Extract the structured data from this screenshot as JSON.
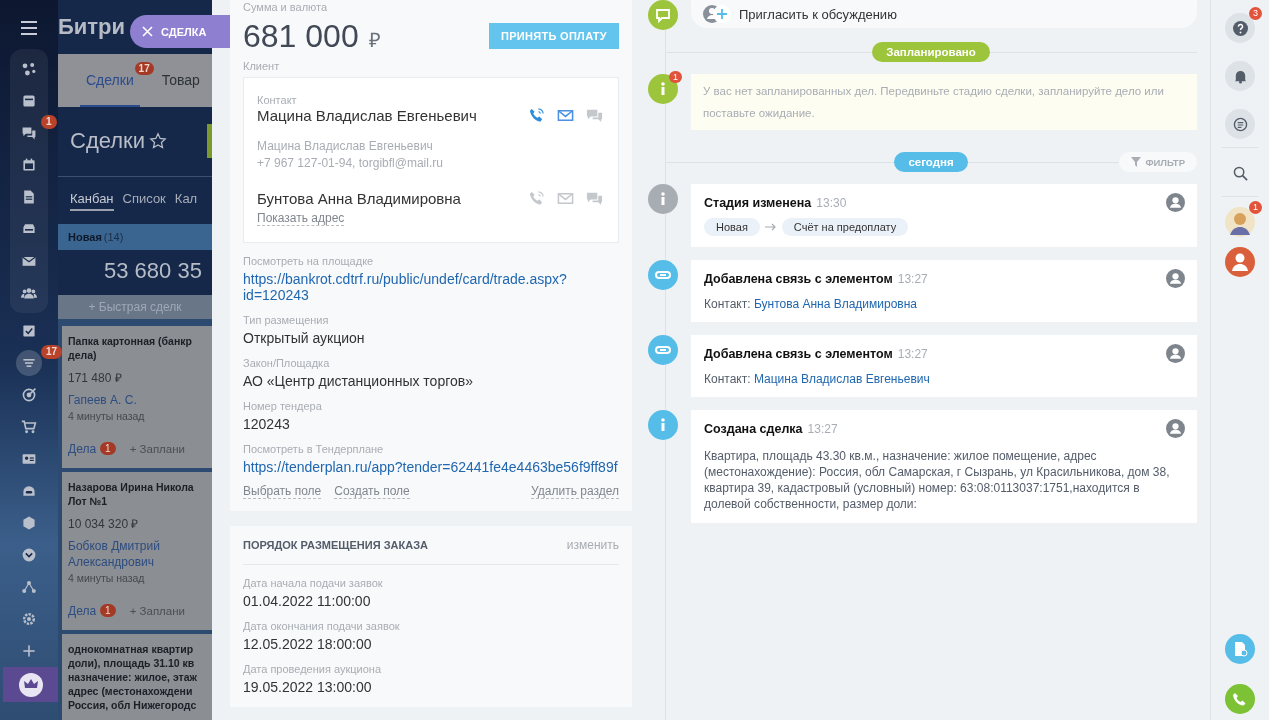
{
  "nav": {
    "pinned": [
      {
        "selected": false
      },
      {
        "selected": false
      },
      {
        "selected": false,
        "badge": "1"
      },
      {
        "selected": false
      },
      {
        "selected": false
      },
      {
        "selected": false
      },
      {
        "selected": false
      },
      {
        "selected": false
      }
    ],
    "items": [
      {
        "selected": false
      },
      {
        "selected": true,
        "badge": "17"
      },
      {
        "selected": false
      },
      {
        "selected": false
      },
      {
        "selected": false
      },
      {
        "selected": false
      },
      {
        "selected": false
      },
      {
        "selected": false
      },
      {
        "selected": false
      },
      {
        "selected": false
      },
      {
        "selected": false
      }
    ]
  },
  "app_title": "Битри",
  "slider_tab": {
    "label": "СДЕЛКА"
  },
  "crm_tabs": [
    {
      "label": "Сделки",
      "badge": "17",
      "selected": true
    },
    {
      "label": "Товар",
      "selected": false
    }
  ],
  "page_title": "Сделки",
  "views": [
    {
      "label": "Канбан",
      "selected": true
    },
    {
      "label": "Список",
      "selected": false
    },
    {
      "label": "Кал",
      "selected": false
    }
  ],
  "kanban_column": {
    "name": "Новая",
    "count": "(14)",
    "total": "53 680 35",
    "quick_add": "+ Быстрая сделк",
    "cards": [
      {
        "title": [
          "Папка картонная (банкр",
          "дела)"
        ],
        "price": "171 480 ₽",
        "person": "Гапеев А. С.",
        "time": "4 минуты назад",
        "activity": "Дела",
        "activity_badge": "1",
        "plan": "+ Заплани"
      },
      {
        "title": [
          "Назарова Ирина Никола",
          "Лот №1"
        ],
        "price": "10 034 320 ₽",
        "person": "Бобков Дмитрий Александрович",
        "time": "4 минуты назад",
        "activity": "Дела",
        "activity_badge": "1",
        "plan": "+ Заплани"
      },
      {
        "title": [
          "однокомнатная квартир",
          "доли), площадь 31.10 кв",
          "назначение: жилое, этаж",
          "адрес (местонахождени",
          "Россия, обл Нижегородс"
        ]
      }
    ]
  },
  "deal": {
    "amount_label": "Сумма и валюта",
    "amount": "681 000",
    "currency": "₽",
    "pay_button": "ПРИНЯТЬ ОПЛАТУ",
    "client_label": "Клиент",
    "contact_label": "Контакт",
    "contacts": [
      {
        "name": "Мацина Владислав Евгеньевич",
        "active": true,
        "details": [
          "Мацина Владислав Евгеньевич",
          "+7 967 127-01-94, torgibfl@mail.ru"
        ]
      },
      {
        "name": "Бунтова Анна Владимировна",
        "active": false,
        "link": "Показать адрес"
      }
    ],
    "fields": [
      {
        "label": "Посмотреть на площадке",
        "value": "https://bankrot.cdtrf.ru/public/undef/card/trade.aspx?id=120243",
        "kind": "link"
      },
      {
        "label": "Тип размещения",
        "value": "Открытый аукцион",
        "kind": "text"
      },
      {
        "label": "Закон/Площадка",
        "value": "АО «Центр дистанционных торгов»",
        "kind": "text"
      },
      {
        "label": "Номер тендера",
        "value": "120243",
        "kind": "text"
      },
      {
        "label": "Посмотреть в Тендерплане",
        "value": "https://tenderplan.ru/app?tender=62441fe4e4463be56f9ff89f",
        "kind": "link"
      }
    ],
    "actions": [
      "Выбрать поле",
      "Создать поле"
    ],
    "delete_action": "Удалить раздел"
  },
  "order_section": {
    "title": "ПОРЯДОК РАЗМЕЩЕНИЯ ЗАКАЗА",
    "edit": "изменить",
    "fields": [
      {
        "label": "Дата начала подачи заявок",
        "value": "01.04.2022 11:00:00"
      },
      {
        "label": "Дата окончания подачи заявок",
        "value": "12.05.2022 18:00:00"
      },
      {
        "label": "Дата проведения аукциона",
        "value": "19.05.2022 13:00:00"
      }
    ]
  },
  "timeline": {
    "invite": "Пригласить к обсуждению",
    "planned_label": "Запланировано",
    "planned_note": {
      "text": "У вас нет запланированных дел. Передвиньте стадию сделки, запланируйте дело или поставьте ожидание.",
      "badge": "1"
    },
    "today_label": "сегодня",
    "filter": "ФИЛЬТР",
    "events": [
      {
        "color": "#a8adb4",
        "title": "Стадия изменена",
        "time": "13:30",
        "kind": "stage",
        "from": "Новая",
        "to": "Счёт на предоплату"
      },
      {
        "color": "#55bde8",
        "title": "Добавлена связь с элементом",
        "time": "13:27",
        "kind": "contact",
        "prefix": "Контакт:",
        "contact": "Бунтова Анна Владимировна"
      },
      {
        "color": "#55bde8",
        "title": "Добавлена связь с элементом",
        "time": "13:27",
        "kind": "contact",
        "prefix": "Контакт:",
        "contact": "Мацина Владислав Евгеньевич"
      },
      {
        "color": "#55bde8",
        "title": "Создана сделка",
        "time": "13:27",
        "kind": "text",
        "text": "Квартира, площадь 43.30 кв.м., назначение: жилое помещение, адрес (местонахождение): Россия, обл Самарская, г Сызрань, ул Красильникова, дом 38, квартира 39, кадастровый (условный) номер: 63:08:0113037:1751,находится в долевой собственности, размер доли:"
      }
    ]
  },
  "right_bar": {
    "help_badge": "3",
    "avatar_badge": "1"
  }
}
